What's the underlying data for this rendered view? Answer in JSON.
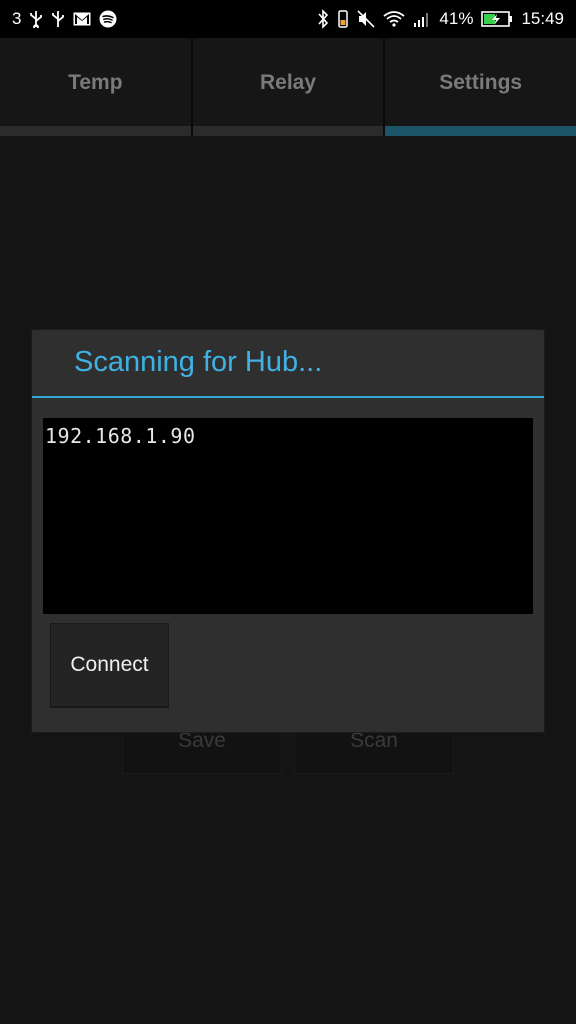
{
  "status_bar": {
    "notification_count": "3",
    "battery_percent": "41%",
    "time": "15:49",
    "left_icons": [
      "usb-icon",
      "usb-icon",
      "gmail-icon",
      "spotify-icon"
    ],
    "right_icons": [
      "bluetooth-icon",
      "vibrate-icon",
      "mute-icon",
      "wifi-icon",
      "signal-icon",
      "battery-charging-icon"
    ]
  },
  "tabs": [
    {
      "label": "Temp",
      "active": false
    },
    {
      "label": "Relay",
      "active": false
    },
    {
      "label": "Settings",
      "active": true
    }
  ],
  "background_buttons": {
    "save_label": "Save",
    "scan_label": "Scan"
  },
  "dialog": {
    "title": "Scanning for Hub...",
    "ip_list": "192.168.1.90",
    "connect_label": "Connect"
  },
  "colors": {
    "accent": "#3fb1e3",
    "tab_indicator_active": "#1e5468",
    "background": "#141414",
    "dialog_bg": "#2f2f2f"
  }
}
